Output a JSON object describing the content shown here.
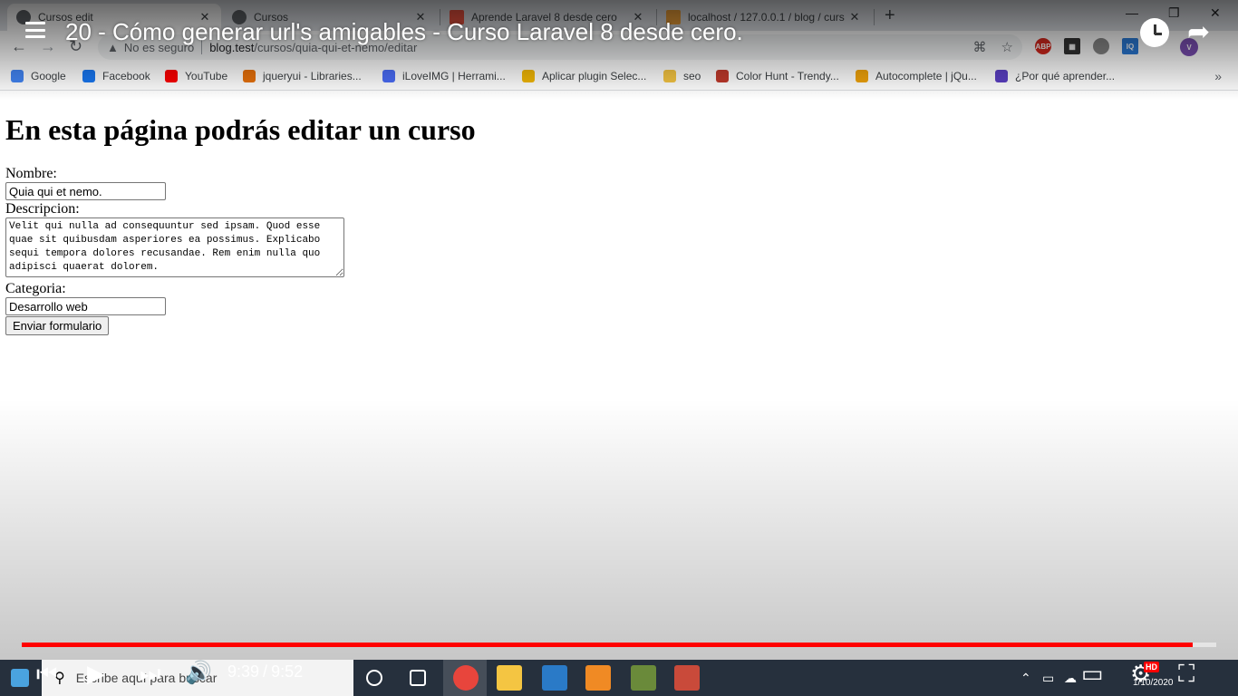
{
  "browser": {
    "tabs": [
      {
        "label": "Cursos edit",
        "close": "✕"
      },
      {
        "label": "Cursos",
        "close": "✕"
      },
      {
        "label": "Aprende Laravel 8 desde cero",
        "close": "✕"
      },
      {
        "label": "localhost / 127.0.0.1 / blog / curs",
        "close": "✕"
      }
    ],
    "new_tab": "+",
    "window_controls": {
      "minimize": "—",
      "restore": "❐",
      "close": "✕"
    },
    "address": {
      "warning_icon": "▲",
      "security_text": "No es seguro",
      "host": "blog.test",
      "path": "/cursos/quia-qui-et-nemo/editar"
    },
    "nav": {
      "back": "←",
      "forward": "→",
      "reload": "↻"
    },
    "extensions": [
      {
        "name": "adblock-icon",
        "text": "ABP",
        "color": "#d7281e"
      },
      {
        "name": "qr-icon",
        "text": "▦",
        "color": "#333333"
      },
      {
        "name": "iq-icon",
        "text": "IQ",
        "color": "#2b7bd9"
      },
      {
        "name": "avatar-icon",
        "text": "V",
        "color": "#7b4fb3"
      }
    ],
    "bookmarks": [
      {
        "label": "Google",
        "color": "#4285f4"
      },
      {
        "label": "Facebook",
        "color": "#1877f2"
      },
      {
        "label": "YouTube",
        "color": "#ff0000"
      },
      {
        "label": "jqueryui - Libraries...",
        "color": "#e8710a"
      },
      {
        "label": "iLoveIMG | Herrami...",
        "color": "#4a6cf7"
      },
      {
        "label": "Aplicar plugin Selec...",
        "color": "#f2b705"
      },
      {
        "label": "seo",
        "color": "#f5c542"
      },
      {
        "label": "Color Hunt - Trendy...",
        "color": "#c0392b"
      },
      {
        "label": "Autocomplete | jQu...",
        "color": "#f0a30a"
      },
      {
        "label": "¿Por qué aprender...",
        "color": "#5b3fc4"
      }
    ],
    "bookmarks_more": "»"
  },
  "page": {
    "heading": "En esta página podrás editar un curso",
    "form": {
      "name_label": "Nombre:",
      "name_value": "Quia qui et nemo.",
      "description_label": "Descripcion:",
      "description_value": "Velit qui nulla ad consequuntur sed ipsam. Quod esse quae sit quibusdam asperiores ea possimus. Explicabo sequi tempora dolores recusandae. Rem enim nulla quo adipisci quaerat dolorem.",
      "category_label": "Categoria:",
      "category_value": "Desarrollo web",
      "submit_label": "Enviar formulario"
    }
  },
  "video": {
    "title": "20 - Cómo generar url's amigables - Curso Laravel 8 desde cero.",
    "current_time": "9:39",
    "time_separator": "/",
    "duration": "9:52",
    "progress": 0.98,
    "hd_badge": "HD",
    "controls": {
      "prev": "⏮",
      "play": "▶",
      "next": "⏭",
      "volume": "🔊",
      "subtitles": "▭",
      "settings": "⚙",
      "fullscreen_exit": "⛶",
      "share": "➦"
    }
  },
  "taskbar": {
    "search_placeholder": "Escribe aquí para buscar",
    "date": "1/10/2020"
  },
  "colors": {
    "progress": "#ff0000",
    "page_bg": "#ffffff"
  }
}
